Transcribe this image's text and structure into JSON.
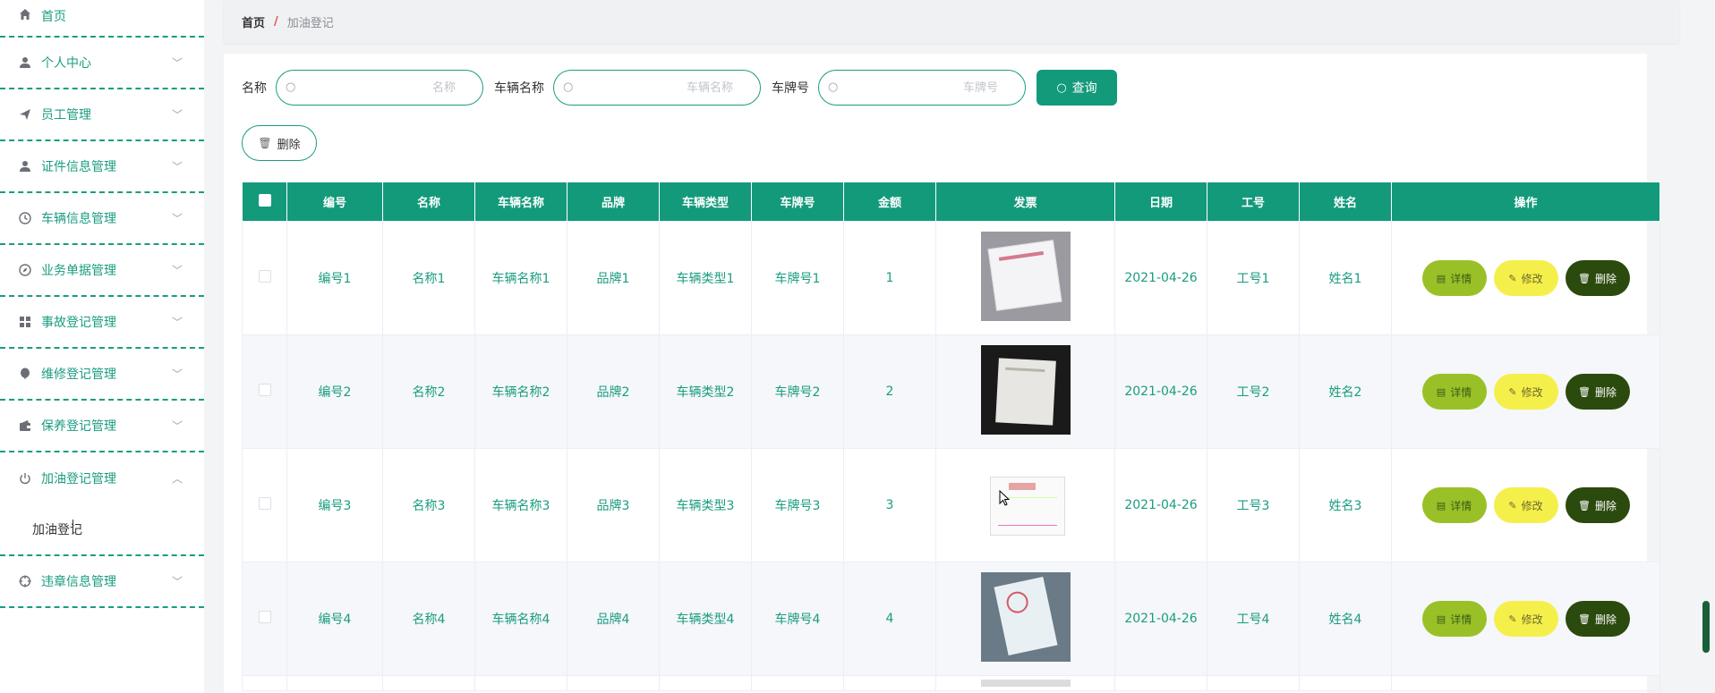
{
  "sidebar": {
    "items": [
      {
        "label": "首页",
        "icon": "home-icon"
      },
      {
        "label": "个人中心",
        "icon": "user-icon"
      },
      {
        "label": "员工管理",
        "icon": "send-icon"
      },
      {
        "label": "证件信息管理",
        "icon": "user-icon"
      },
      {
        "label": "车辆信息管理",
        "icon": "clock-icon"
      },
      {
        "label": "业务单据管理",
        "icon": "compass-icon"
      },
      {
        "label": "事故登记管理",
        "icon": "grid-icon"
      },
      {
        "label": "维修登记管理",
        "icon": "balloon-icon"
      },
      {
        "label": "保养登记管理",
        "icon": "wallet-icon"
      },
      {
        "label": "加油登记管理",
        "icon": "power-icon"
      },
      {
        "label": "违章信息管理",
        "icon": "crosshair-icon"
      }
    ],
    "submenu": {
      "label": "加油登记"
    }
  },
  "breadcrumb": {
    "home": "首页",
    "separator": "/",
    "current": "加油登记"
  },
  "search": {
    "name_label": "名称",
    "name_placeholder": "名称",
    "vehicle_label": "车辆名称",
    "vehicle_placeholder": "车辆名称",
    "plate_label": "车牌号",
    "plate_placeholder": "车牌号",
    "query_label": "查询"
  },
  "toolbar": {
    "delete_label": "删除"
  },
  "table": {
    "headers": [
      "编号",
      "名称",
      "车辆名称",
      "品牌",
      "车辆类型",
      "车牌号",
      "金额",
      "发票",
      "日期",
      "工号",
      "姓名",
      "操作"
    ],
    "rows": [
      {
        "code": "编号1",
        "name": "名称1",
        "vehicle": "车辆名称1",
        "brand": "品牌1",
        "type": "车辆类型1",
        "plate": "车牌号1",
        "amount": "1",
        "date": "2021-04-26",
        "emp": "工号1",
        "person": "姓名1"
      },
      {
        "code": "编号2",
        "name": "名称2",
        "vehicle": "车辆名称2",
        "brand": "品牌2",
        "type": "车辆类型2",
        "plate": "车牌号2",
        "amount": "2",
        "date": "2021-04-26",
        "emp": "工号2",
        "person": "姓名2"
      },
      {
        "code": "编号3",
        "name": "名称3",
        "vehicle": "车辆名称3",
        "brand": "品牌3",
        "type": "车辆类型3",
        "plate": "车牌号3",
        "amount": "3",
        "date": "2021-04-26",
        "emp": "工号3",
        "person": "姓名3"
      },
      {
        "code": "编号4",
        "name": "名称4",
        "vehicle": "车辆名称4",
        "brand": "品牌4",
        "type": "车辆类型4",
        "plate": "车牌号4",
        "amount": "4",
        "date": "2021-04-26",
        "emp": "工号4",
        "person": "姓名4"
      }
    ],
    "actions": {
      "detail": "详情",
      "edit": "修改",
      "delete": "删除"
    }
  },
  "colors": {
    "primary": "#139a7b",
    "detail": "#99c127",
    "edit": "#f5ef4b",
    "delete": "#2b4a0d"
  }
}
